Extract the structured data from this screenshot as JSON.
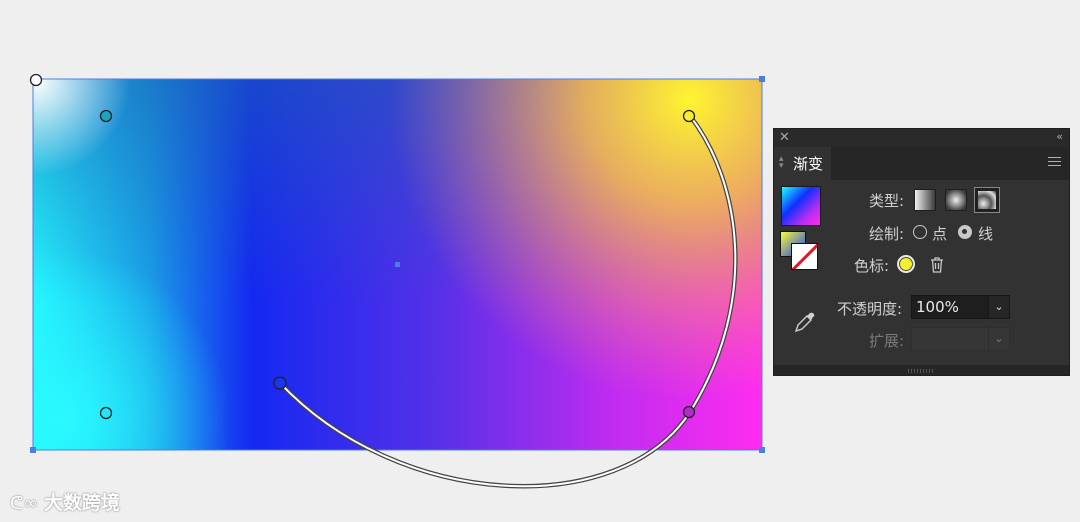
{
  "canvas": {
    "gradient_colors": [
      "#2afbff",
      "#1030ff",
      "#7030f0",
      "#ff2df0",
      "#fff63a",
      "#ffffff"
    ],
    "selection_color": "#4a7fe0"
  },
  "panel": {
    "close_icon": "close-icon",
    "collapse_label": "‹‹",
    "tab_label": "渐变",
    "menu_icon": "hamburger-menu-icon",
    "type_label": "类型:",
    "types": [
      "linear-gradient",
      "radial-gradient",
      "freeform-gradient"
    ],
    "selected_type": "freeform-gradient",
    "draw_label": "绘制:",
    "draw_options": [
      "点",
      "线"
    ],
    "draw_selected": "线",
    "stop_label": "色标:",
    "stop_color": "#f4f030",
    "opacity_label": "不透明度:",
    "opacity_value": "100%",
    "spread_label": "扩展:",
    "spread_value": ""
  },
  "watermark": {
    "text": "大数跨境"
  }
}
